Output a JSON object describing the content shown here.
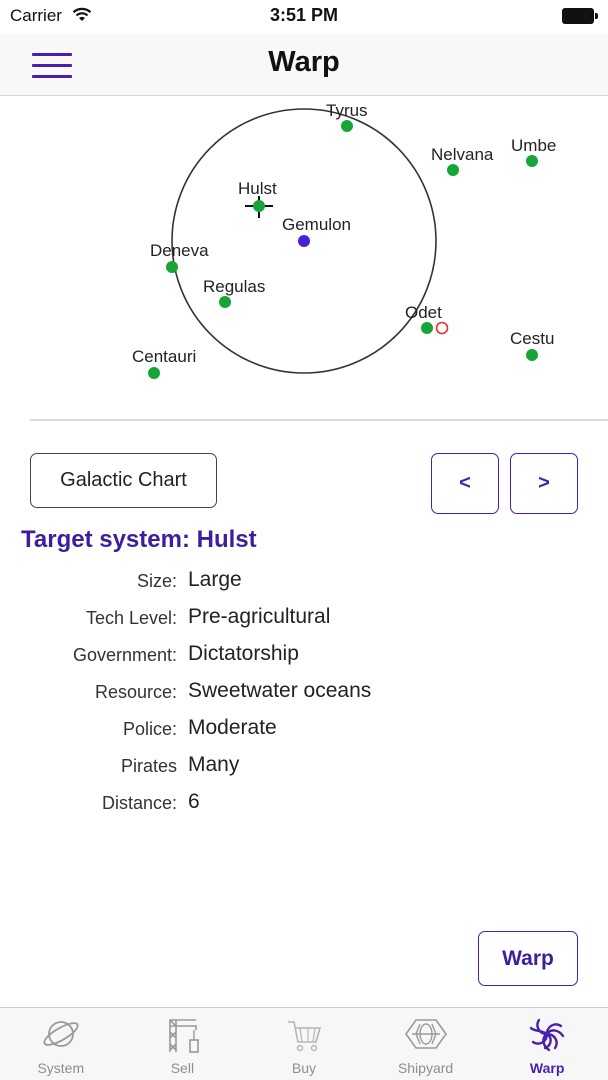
{
  "status_bar": {
    "carrier": "Carrier",
    "time": "3:51 PM"
  },
  "nav": {
    "title": "Warp",
    "menu_icon": "hamburger-menu-icon"
  },
  "galaxy_map": {
    "systems": [
      {
        "name": "Tyrus",
        "status": "in-range"
      },
      {
        "name": "Nelvana",
        "status": "out-of-range"
      },
      {
        "name": "Umbe",
        "status": "out-of-range"
      },
      {
        "name": "Hulst",
        "status": "in-range",
        "targeted": true
      },
      {
        "name": "Gemulon",
        "status": "current"
      },
      {
        "name": "Deneva",
        "status": "in-range"
      },
      {
        "name": "Regulas",
        "status": "in-range"
      },
      {
        "name": "Odet",
        "status": "in-range",
        "wormhole": true
      },
      {
        "name": "Cestu",
        "status": "out-of-range"
      },
      {
        "name": "Centauri",
        "status": "out-of-range"
      }
    ],
    "colors": {
      "system": "#17a538",
      "current_system": "#4a1fd6",
      "range_circle": "#333333",
      "wormhole": "#e03030"
    }
  },
  "controls": {
    "galactic_chart_label": "Galactic Chart",
    "prev_label": "<",
    "next_label": ">"
  },
  "target": {
    "title": "Target system: Hulst",
    "rows": [
      {
        "label": "Size:",
        "value": "Large"
      },
      {
        "label": "Tech Level:",
        "value": "Pre-agricultural"
      },
      {
        "label": "Government:",
        "value": "Dictatorship"
      },
      {
        "label": "Resource:",
        "value": "Sweetwater oceans"
      },
      {
        "label": "Police:",
        "value": "Moderate"
      },
      {
        "label": "Pirates",
        "value": "Many"
      },
      {
        "label": "Distance:",
        "value": "6"
      }
    ]
  },
  "warp_button_label": "Warp",
  "accent_color": "#4a1fb0",
  "tabs": [
    {
      "label": "System",
      "icon": "planet-icon",
      "active": false
    },
    {
      "label": "Sell",
      "icon": "crane-icon",
      "active": false
    },
    {
      "label": "Buy",
      "icon": "cart-icon",
      "active": false
    },
    {
      "label": "Shipyard",
      "icon": "ship-icon",
      "active": false
    },
    {
      "label": "Warp",
      "icon": "warp-spiral-icon",
      "active": true
    }
  ]
}
